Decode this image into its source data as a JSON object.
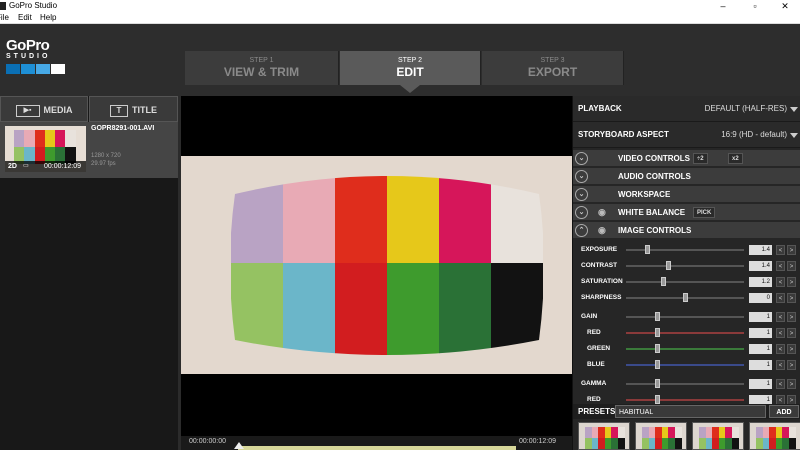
{
  "window": {
    "title": "GoPro Studio"
  },
  "menu": [
    "File",
    "Edit",
    "Help"
  ],
  "logo": {
    "line1": "GoPro",
    "line2": "STUDIO",
    "squares": [
      "#0a6fb4",
      "#1e8fd5",
      "#47a9e6",
      "#ffffff"
    ]
  },
  "steps": [
    {
      "small": "STEP 1",
      "label": "VIEW & TRIM"
    },
    {
      "small": "STEP 2",
      "label": "EDIT"
    },
    {
      "small": "STEP 3",
      "label": "EXPORT"
    }
  ],
  "left": {
    "tabs": {
      "media": "MEDIA",
      "title": "TITLE"
    },
    "item": {
      "name": "GOPR8291-001.AVI",
      "resolution": "1280 x 720",
      "fps": "29.97 fps",
      "badge_2d": "2D",
      "duration": "00:00:12:09"
    }
  },
  "timeline": {
    "start": "00:00:00:00",
    "end": "00:00:12:09"
  },
  "playback": {
    "label": "PLAYBACK",
    "value": "DEFAULT (HALF-RES)"
  },
  "storyboard": {
    "label": "STORYBOARD ASPECT",
    "value": "16:9 (HD - default)"
  },
  "sections": {
    "video": {
      "label": "VIDEO CONTROLS",
      "b1": "÷2",
      "b2": "x2"
    },
    "audio": {
      "label": "AUDIO CONTROLS"
    },
    "workspace": {
      "label": "WORKSPACE"
    },
    "wb": {
      "label": "WHITE BALANCE",
      "pick": "PICK"
    },
    "image": {
      "label": "IMAGE CONTROLS"
    }
  },
  "controls": [
    {
      "label": "EXPOSURE",
      "value": "1.4",
      "pos": 0.18
    },
    {
      "label": "CONTRAST",
      "value": "1.4",
      "pos": 0.36
    },
    {
      "label": "SATURATION",
      "value": "1.2",
      "pos": 0.31
    },
    {
      "label": "SHARPNESS",
      "value": "0",
      "pos": 0.5
    },
    {
      "label": "GAIN",
      "value": "1",
      "pos": 0.26
    },
    {
      "label": "RED",
      "value": "1",
      "pos": 0.26
    },
    {
      "label": "GREEN",
      "value": "1",
      "pos": 0.26
    },
    {
      "label": "BLUE",
      "value": "1",
      "pos": 0.26
    },
    {
      "label": "GAMMA",
      "value": "1",
      "pos": 0.26
    },
    {
      "label": "RED",
      "value": "1",
      "pos": 0.26
    }
  ],
  "presets": {
    "label": "PRESETS",
    "name": "HABITUAL",
    "add": "ADD"
  },
  "colors": {
    "top_bars": [
      "#b9a3c4",
      "#e8aab5",
      "#df2d1c",
      "#e6c81a",
      "#d6165a",
      "#e8e2dc"
    ],
    "bottom_bars": [
      "#95c262",
      "#6bb6c9",
      "#d21d1f",
      "#3e9b2d",
      "#2a7136",
      "#121212"
    ]
  }
}
